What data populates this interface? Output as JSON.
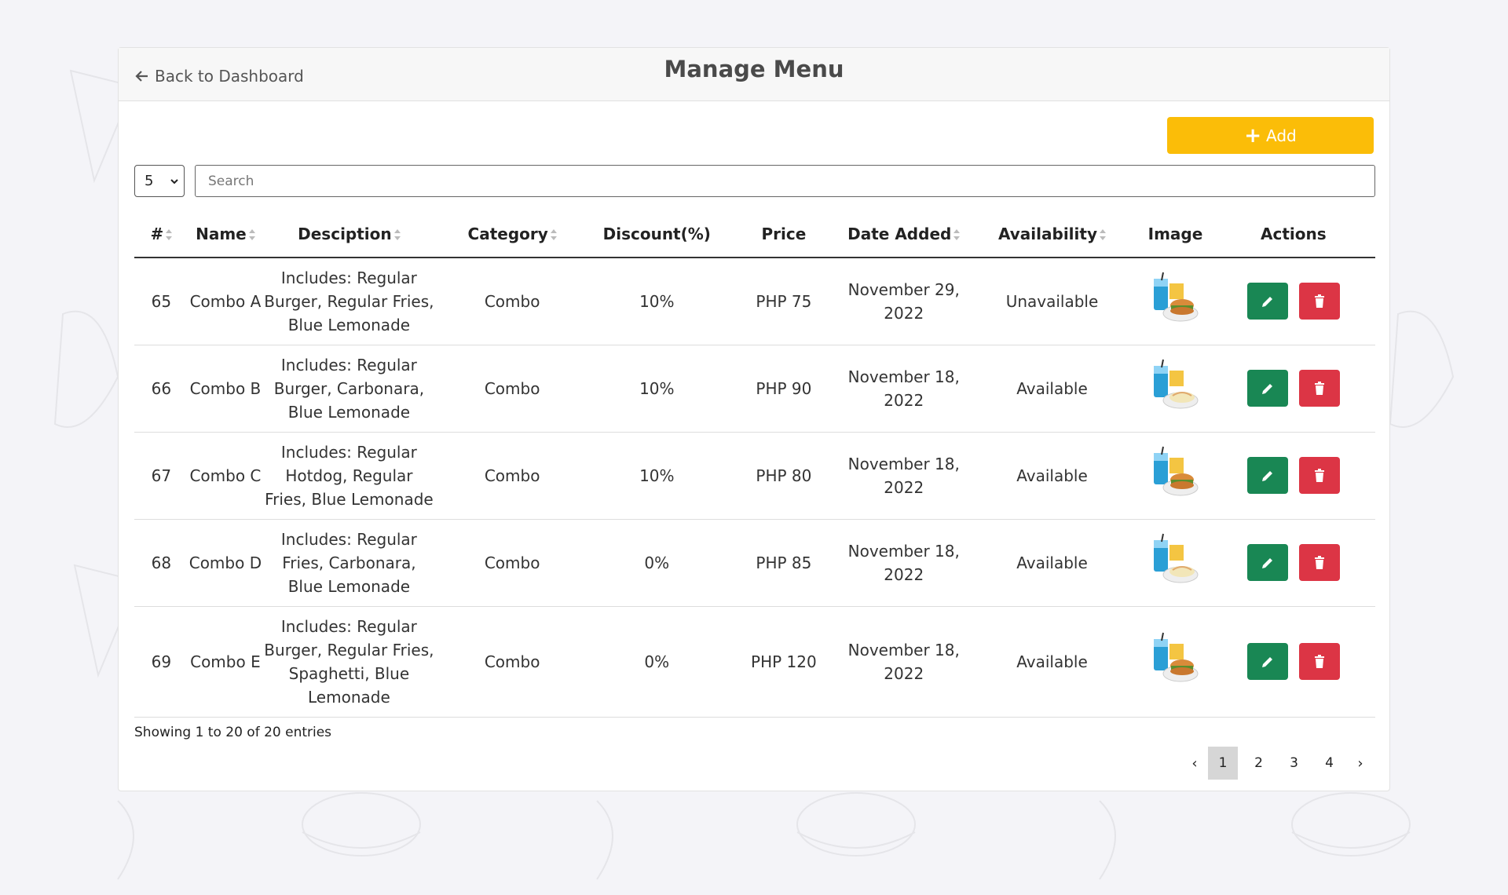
{
  "header": {
    "back_label": "Back to Dashboard",
    "title": "Manage Menu"
  },
  "toolbar": {
    "add_label": "Add",
    "page_length": "5",
    "search_placeholder": "Search"
  },
  "table": {
    "columns": [
      "#",
      "Name",
      "Desciption",
      "Category",
      "Discount(%)",
      "Price",
      "Date Added",
      "Availability",
      "Image",
      "Actions"
    ],
    "rows": [
      {
        "id": "65",
        "name": "Combo A",
        "description": "Includes: Regular Burger, Regular Fries, Blue Lemonade",
        "category": "Combo",
        "discount": "10%",
        "price": "PHP 75",
        "date": "November 29, 2022",
        "availability": "Unavailable",
        "image": "combo-burger-fries-drink-image"
      },
      {
        "id": "66",
        "name": "Combo B",
        "description": "Includes: Regular Burger, Carbonara, Blue Lemonade",
        "category": "Combo",
        "discount": "10%",
        "price": "PHP 90",
        "date": "November 18, 2022",
        "availability": "Available",
        "image": "combo-burger-pasta-drink-image"
      },
      {
        "id": "67",
        "name": "Combo C",
        "description": "Includes: Regular Hotdog, Regular Fries, Blue Lemonade",
        "category": "Combo",
        "discount": "10%",
        "price": "PHP 80",
        "date": "November 18, 2022",
        "availability": "Available",
        "image": "combo-hotdog-fries-drink-image"
      },
      {
        "id": "68",
        "name": "Combo D",
        "description": "Includes: Regular Fries, Carbonara, Blue Lemonade",
        "category": "Combo",
        "discount": "0%",
        "price": "PHP 85",
        "date": "November 18, 2022",
        "availability": "Available",
        "image": "combo-fries-pasta-drink-image"
      },
      {
        "id": "69",
        "name": "Combo E",
        "description": "Includes: Regular Burger, Regular Fries, Spaghetti, Blue Lemonade",
        "category": "Combo",
        "discount": "0%",
        "price": "PHP 120",
        "date": "November 18, 2022",
        "availability": "Available",
        "image": "combo-burger-spaghetti-drink-image"
      }
    ]
  },
  "footer": {
    "info": "Showing 1 to 20 of 20 entries",
    "pages": [
      "1",
      "2",
      "3",
      "4"
    ],
    "prev": "‹",
    "next": "›",
    "active_page": "1"
  },
  "colors": {
    "add_button": "#fbbd08",
    "edit_button": "#198754",
    "delete_button": "#dc3545"
  }
}
